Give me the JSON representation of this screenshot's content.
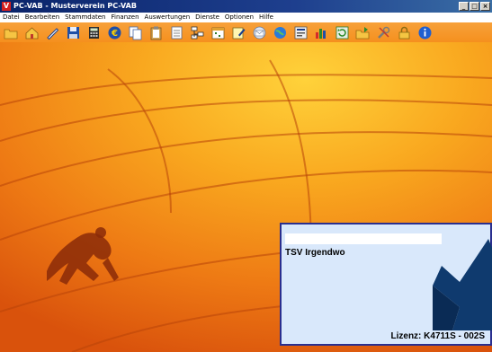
{
  "window": {
    "title": "PC-VAB - Musterverein PC-VAB",
    "logo_letter": "V",
    "controls": [
      "_",
      "□",
      "×"
    ]
  },
  "menu": [
    "Datei",
    "Bearbeiten",
    "Stammdaten",
    "Finanzen",
    "Auswertungen",
    "Dienste",
    "Optionen",
    "Hilfe"
  ],
  "toolbar": {
    "icons": [
      "open-folder-icon",
      "home-icon",
      "pen-icon",
      "save-icon",
      "calculator-icon",
      "euro-icon",
      "copy-icon",
      "clipboard-icon",
      "document-icon",
      "tree-icon",
      "calendar-icon",
      "edit-note-icon",
      "mail-icon",
      "globe-icon",
      "report-icon",
      "bar-chart-icon",
      "refresh-icon",
      "folder-export-icon",
      "tools-icon",
      "lock-icon",
      "info-icon"
    ]
  },
  "license": {
    "club_name": "TSV Irgendwo",
    "key_text": "Lizenz: K4711S - 002S"
  },
  "colors": {
    "background": "#f7931e",
    "titlebar": "#0a246a",
    "license_box": "#d9e8fb",
    "license_border": "#2a2f8f"
  }
}
